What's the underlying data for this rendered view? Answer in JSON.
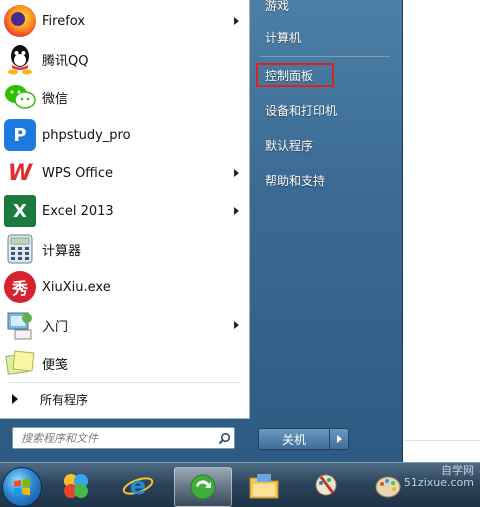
{
  "programs": [
    {
      "label": "Firefox",
      "icon": "firefox-icon",
      "has_submenu": true
    },
    {
      "label": "腾讯QQ",
      "icon": "qq-icon",
      "has_submenu": false
    },
    {
      "label": "微信",
      "icon": "wechat-icon",
      "has_submenu": false
    },
    {
      "label": "phpstudy_pro",
      "icon": "phpstudy-icon",
      "glyph": "P",
      "has_submenu": false
    },
    {
      "label": "WPS Office",
      "icon": "wps-icon",
      "glyph": "W",
      "has_submenu": true
    },
    {
      "label": "Excel 2013",
      "icon": "excel-icon",
      "glyph": "X",
      "has_submenu": true
    },
    {
      "label": "计算器",
      "icon": "calculator-icon",
      "has_submenu": false
    },
    {
      "label": "XiuXiu.exe",
      "icon": "xiuxiu-icon",
      "glyph": "秀",
      "has_submenu": false
    },
    {
      "label": "入门",
      "icon": "getting-started-icon",
      "has_submenu": true
    },
    {
      "label": "便笺",
      "icon": "sticky-notes-icon",
      "has_submenu": false
    }
  ],
  "all_programs_label": "所有程序",
  "search": {
    "placeholder": "搜索程序和文件"
  },
  "right_pane": {
    "items": [
      "游戏",
      "计算机",
      "控制面板",
      "设备和打印机",
      "默认程序",
      "帮助和支持"
    ],
    "highlighted": "控制面板"
  },
  "shutdown_label": "关机",
  "watermark": {
    "line1": "自学网",
    "line2": "51zixue.com"
  },
  "colors": {
    "highlight_border": "#e02020",
    "menu_blue": "#3b6b94",
    "taskbar": "#2a4258"
  }
}
